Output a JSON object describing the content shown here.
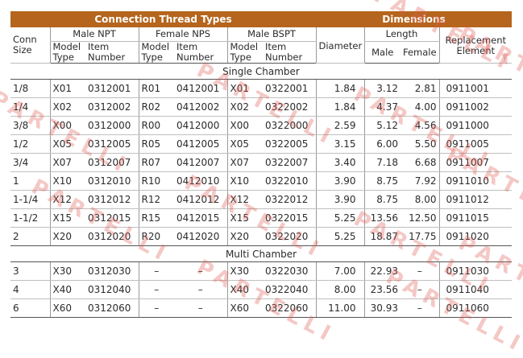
{
  "table": {
    "band": {
      "left": "Connection Thread Types",
      "right": "Dimensions"
    },
    "headers": {
      "conn_size": "Conn\nSize",
      "male_npt": "Male NPT",
      "female_nps": "Female NPS",
      "male_bspt": "Male BSPT",
      "diameter": "Diameter",
      "length": "Length",
      "replacement": "Replacement\nElement",
      "model_type": "Model\nType",
      "item_number": "Item\nNumber",
      "male": "Male",
      "female": "Female"
    },
    "groups": [
      {
        "label": "Single Chamber",
        "rows": [
          [
            "1/8",
            "X01",
            "0312001",
            "R01",
            "0412001",
            "X01",
            "0322001",
            "1.84",
            "3.12",
            "2.81",
            "0911001"
          ],
          [
            "1/4",
            "X02",
            "0312002",
            "R02",
            "0412002",
            "X02",
            "0322002",
            "1.84",
            "4.37",
            "4.00",
            "0911002"
          ],
          [
            "3/8",
            "X00",
            "0312000",
            "R00",
            "0412000",
            "X00",
            "0322000",
            "2.59",
            "5.12",
            "4.56",
            "0911000"
          ],
          [
            "1/2",
            "X05",
            "0312005",
            "R05",
            "0412005",
            "X05",
            "0322005",
            "3.15",
            "6.00",
            "5.50",
            "0911005"
          ],
          [
            "3/4",
            "X07",
            "0312007",
            "R07",
            "0412007",
            "X07",
            "0322007",
            "3.40",
            "7.18",
            "6.68",
            "0911007"
          ],
          [
            "1",
            "X10",
            "0312010",
            "R10",
            "0412010",
            "X10",
            "0322010",
            "3.90",
            "8.75",
            "7.92",
            "0911010"
          ],
          [
            "1-1/4",
            "X12",
            "0312012",
            "R12",
            "0412012",
            "X12",
            "0322012",
            "3.90",
            "8.75",
            "8.00",
            "0911012"
          ],
          [
            "1-1/2",
            "X15",
            "0312015",
            "R15",
            "0412015",
            "X15",
            "0322015",
            "5.25",
            "13.56",
            "12.50",
            "0911015"
          ],
          [
            "2",
            "X20",
            "0312020",
            "R20",
            "0412020",
            "X20",
            "0322020",
            "5.25",
            "18.87",
            "17.75",
            "0911020"
          ]
        ]
      },
      {
        "label": "Multi Chamber",
        "rows": [
          [
            "3",
            "X30",
            "0312030",
            "–",
            "–",
            "X30",
            "0322030",
            "7.00",
            "22.93",
            "–",
            "0911030"
          ],
          [
            "4",
            "X40",
            "0312040",
            "–",
            "–",
            "X40",
            "0322040",
            "8.00",
            "23.56",
            "–",
            "0911040"
          ],
          [
            "6",
            "X60",
            "0312060",
            "–",
            "–",
            "X60",
            "0322060",
            "11.00",
            "30.93",
            "–",
            "0911060"
          ]
        ]
      }
    ]
  },
  "watermark": {
    "text": "PARTELLI",
    "color": "#e05a52"
  }
}
